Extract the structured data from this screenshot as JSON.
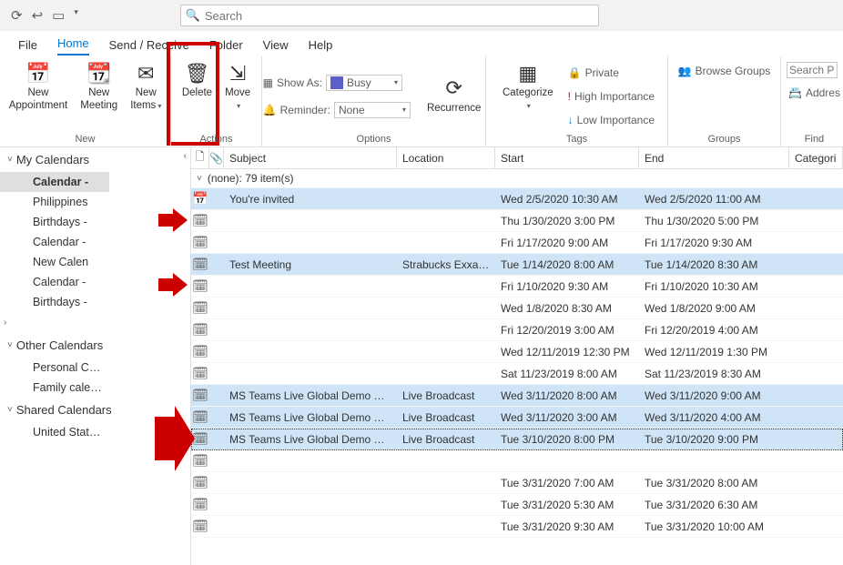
{
  "search": {
    "placeholder": "Search"
  },
  "menutabs": [
    "File",
    "Home",
    "Send / Receive",
    "Folder",
    "View",
    "Help"
  ],
  "ribbon": {
    "new_appt": "New\nAppointment",
    "new_meeting": "New\nMeeting",
    "new_items": "New\nItems",
    "delete": "Delete",
    "move": "Move",
    "show_as": "Show As:",
    "show_as_value": "Busy",
    "reminder": "Reminder:",
    "reminder_value": "None",
    "recurrence": "Recurrence",
    "categorize": "Categorize",
    "private": "Private",
    "high_imp": "High Importance",
    "low_imp": "Low Importance",
    "browse_groups": "Browse Groups",
    "search_people_ph": "Search Pe",
    "address": "Addres",
    "groups": {
      "new": "New",
      "actions": "Actions",
      "options": "Options",
      "tags": "Tags",
      "groupsg": "Groups",
      "find": "Find"
    }
  },
  "nav": {
    "my_calendars": "My Calendars",
    "my_items": [
      "Calendar -",
      "Philippines",
      "Birthdays -",
      "Calendar -",
      "New Calen",
      "Calendar -",
      "Birthdays -"
    ],
    "other_calendars": "Other Calendars",
    "other_items": [
      "Personal Calendar",
      "Family calendar"
    ],
    "shared_calendars": "Shared Calendars",
    "shared_items": [
      "United States holidays"
    ]
  },
  "columns": {
    "subject": "Subject",
    "location": "Location",
    "start": "Start",
    "end": "End",
    "categories": "Categori"
  },
  "group_label": "(none): 79 item(s)",
  "rows": [
    {
      "sel": true,
      "subject": "You're invited",
      "location": "",
      "start": "Wed 2/5/2020 10:30 AM",
      "end": "Wed 2/5/2020 11:00 AM",
      "mtg": true
    },
    {
      "subject": "",
      "location": "",
      "start": "Thu 1/30/2020 3:00 PM",
      "end": "Thu 1/30/2020 5:00 PM"
    },
    {
      "subject": "",
      "location": "",
      "start": "Fri 1/17/2020 9:00 AM",
      "end": "Fri 1/17/2020 9:30 AM"
    },
    {
      "sel": true,
      "subject": "Test Meeting",
      "location": "Strabucks Exxa To...",
      "start": "Tue 1/14/2020 8:00 AM",
      "end": "Tue 1/14/2020 8:30 AM"
    },
    {
      "subject": "",
      "location": "",
      "start": "Fri 1/10/2020 9:30 AM",
      "end": "Fri 1/10/2020 10:30 AM"
    },
    {
      "subject": "",
      "location": "",
      "start": "Wed 1/8/2020 8:30 AM",
      "end": "Wed 1/8/2020 9:00 AM"
    },
    {
      "subject": "",
      "location": "",
      "start": "Fri 12/20/2019 3:00 AM",
      "end": "Fri 12/20/2019 4:00 AM"
    },
    {
      "subject": "",
      "location": "",
      "start": "Wed 12/11/2019 12:30 PM",
      "end": "Wed 12/11/2019 1:30 PM"
    },
    {
      "subject": "",
      "location": "",
      "start": "Sat 11/23/2019 8:00 AM",
      "end": "Sat 11/23/2019 8:30 AM"
    },
    {
      "sel": true,
      "subject": "MS Teams Live Global Demo Sessio...",
      "location": "Live Broadcast",
      "start": "Wed 3/11/2020 8:00 AM",
      "end": "Wed 3/11/2020 9:00 AM"
    },
    {
      "sel": true,
      "subject": "MS Teams Live Global Demo Sessio...",
      "location": "Live Broadcast",
      "start": "Wed 3/11/2020 3:00 AM",
      "end": "Wed 3/11/2020 4:00 AM"
    },
    {
      "sel": true,
      "focus": true,
      "subject": "MS Teams Live Global Demo Sessio...",
      "location": "Live Broadcast",
      "start": "Tue 3/10/2020 8:00 PM",
      "end": "Tue 3/10/2020 9:00 PM"
    },
    {
      "subject": "",
      "location": "",
      "start": "",
      "end": ""
    },
    {
      "subject": "",
      "location": "",
      "start": "Tue 3/31/2020 7:00 AM",
      "end": "Tue 3/31/2020 8:00 AM"
    },
    {
      "subject": "",
      "location": "",
      "start": "Tue 3/31/2020 5:30 AM",
      "end": "Tue 3/31/2020 6:30 AM"
    },
    {
      "subject": "",
      "location": "",
      "start": "Tue 3/31/2020 9:30 AM",
      "end": "Tue 3/31/2020 10:00 AM"
    }
  ]
}
